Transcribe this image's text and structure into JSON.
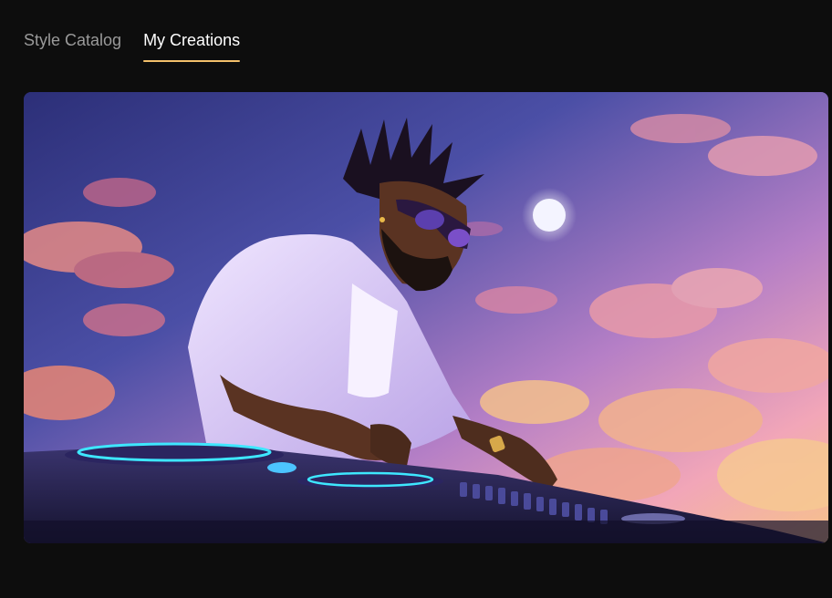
{
  "tabs": [
    {
      "label": "Style Catalog",
      "active": false
    },
    {
      "label": "My Creations",
      "active": true
    }
  ],
  "colors": {
    "background": "#0d0d0d",
    "tab_active": "#ffffff",
    "tab_inactive": "#9a9a9a",
    "tab_underline": "#f3c06b"
  },
  "creation_image": {
    "icon": "generated-image"
  }
}
